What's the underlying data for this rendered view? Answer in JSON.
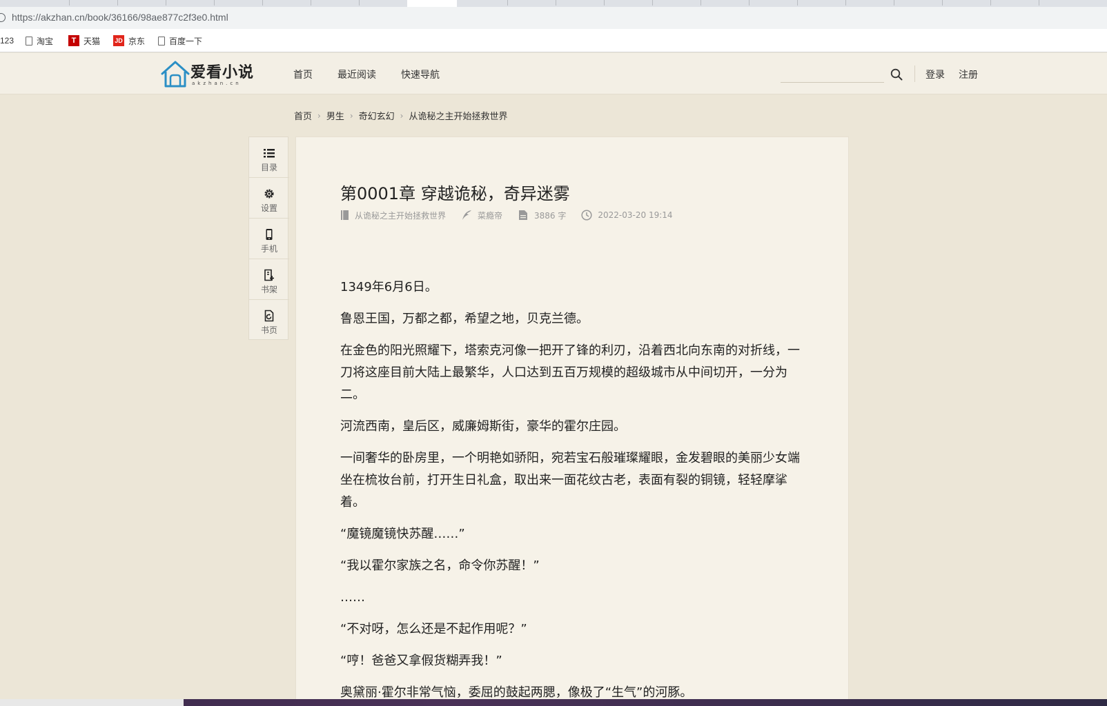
{
  "browser": {
    "url": "https://akzhan.cn/book/36166/98ae877c2f3e0.html",
    "bookmarks": [
      {
        "label": "123",
        "icon": "none"
      },
      {
        "label": "淘宝",
        "icon": "page-icon"
      },
      {
        "label": "天猫",
        "icon": "tmall-icon"
      },
      {
        "label": "京东",
        "icon": "jd-icon"
      },
      {
        "label": "百度一下",
        "icon": "page-icon"
      }
    ],
    "tmall_icon_letter": "T",
    "jd_icon_letters": "JD"
  },
  "site": {
    "logo_text": "爱看小说",
    "logo_sub": "akzhan.cn",
    "nav": [
      "首页",
      "最近阅读",
      "快速导航"
    ],
    "login": "登录",
    "register": "注册",
    "accent_color": "#2b8fc5"
  },
  "breadcrumb": [
    "首页",
    "男生",
    "奇幻玄幻",
    "从诡秘之主开始拯救世界"
  ],
  "toolbar": [
    "目录",
    "设置",
    "手机",
    "书架",
    "书页"
  ],
  "chapter": {
    "title": "第0001章 穿越诡秘，奇异迷雾",
    "book": "从诡秘之主开始拯救世界",
    "author": "菜瘾帝",
    "word_count": "3886 字",
    "date": "2022-03-20 19:14",
    "paragraphs": [
      "1349年6月6日。",
      "鲁恩王国，万都之都，希望之地，贝克兰德。",
      "在金色的阳光照耀下，塔索克河像一把开了锋的利刃，沿着西北向东南的对折线，一刀将这座目前大陆上最繁华，人口达到五百万规模的超级城市从中间切开，一分为二。",
      "河流西南，皇后区，威廉姆斯街，豪华的霍尔庄园。",
      "一间奢华的卧房里，一个明艳如骄阳，宛若宝石般璀璨耀眼，金发碧眼的美丽少女端坐在梳妆台前，打开生日礼盒，取出来一面花纹古老，表面有裂的铜镜，轻轻摩挲着。",
      "“魔镜魔镜快苏醒……”",
      "“我以霍尔家族之名，命令你苏醒！”",
      "……",
      "“不对呀，怎么还是不起作用呢？”",
      "“哼！爸爸又拿假货糊弄我！”",
      "奥黛丽·霍尔非常气恼，委屈的鼓起两腮，像极了“生气”的河豚。"
    ]
  }
}
